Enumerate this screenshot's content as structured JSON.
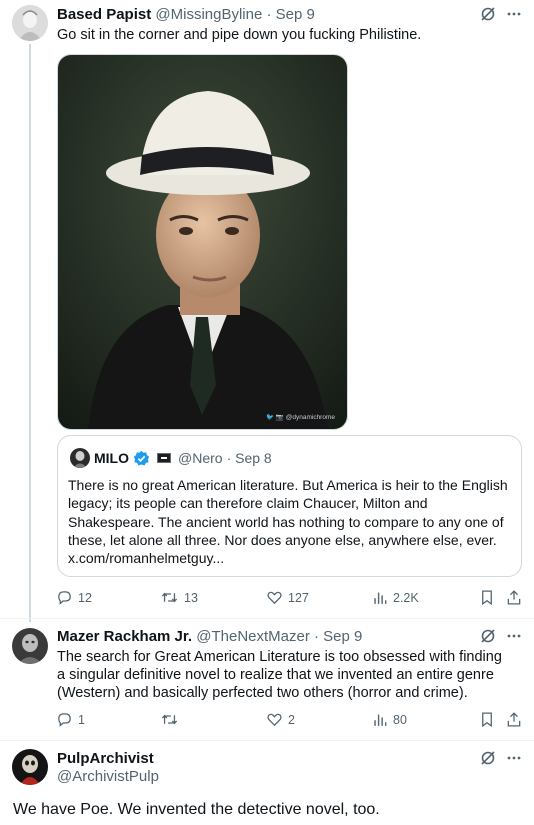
{
  "colors": {
    "text": "#0f1419",
    "muted": "#536471",
    "accent": "#1d9bf0",
    "border": "#cfd9de"
  },
  "tweets": [
    {
      "name": "Based Papist",
      "handle": "@MissingByline",
      "date": "· Sep 9",
      "text": "Go sit in the corner and pipe down you fucking Philistine.",
      "media_credit": "🐦 📷 @dynamichrome",
      "quote": {
        "name": "MILO",
        "handle": "@Nero",
        "date": "· Sep 8",
        "text": "There is no great American literature. But America is heir to the English legacy; its people can therefore claim Chaucer, Milton and Shakespeare. The ancient world has nothing to compare to any one of these, let alone all three. Nor does anyone else, anywhere else, ever. x.com/romanhelmetguy..."
      },
      "stats": {
        "replies": "12",
        "reposts": "13",
        "likes": "127",
        "views": "2.2K"
      }
    },
    {
      "name": "Mazer Rackham Jr.",
      "handle": "@TheNextMazer",
      "date": "· Sep 9",
      "text": "The search for Great American Literature is too obsessed with finding a singular definitive novel to realize that we invented an entire genre (Western) and basically perfected two others (horror and crime).",
      "stats": {
        "replies": "1",
        "reposts": "",
        "likes": "2",
        "views": "80"
      }
    },
    {
      "name": "PulpArchivist",
      "handle": "@ArchivistPulp",
      "text": "We have Poe. We invented the detective novel, too."
    }
  ]
}
